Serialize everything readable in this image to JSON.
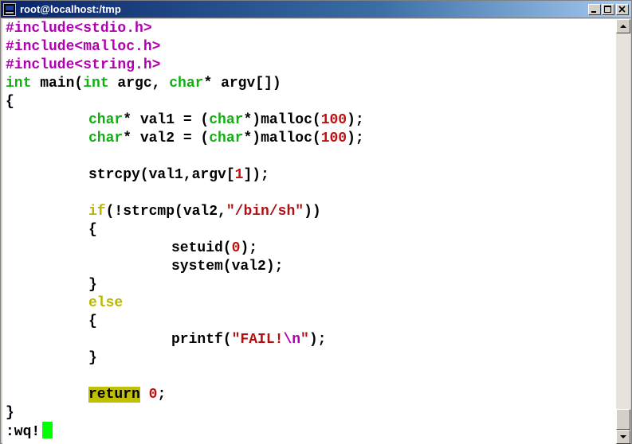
{
  "window": {
    "title": "root@localhost:/tmp"
  },
  "editor": {
    "lines": [
      {
        "segments": [
          {
            "t": "#include<stdio.h>",
            "c": "pre"
          }
        ]
      },
      {
        "segments": [
          {
            "t": "#include<malloc.h>",
            "c": "pre"
          }
        ]
      },
      {
        "segments": [
          {
            "t": "#include<string.h>",
            "c": "pre"
          }
        ]
      },
      {
        "segments": [
          {
            "t": "int",
            "c": "typ"
          },
          {
            "t": " main("
          },
          {
            "t": "int",
            "c": "typ"
          },
          {
            "t": " argc, "
          },
          {
            "t": "char",
            "c": "typ"
          },
          {
            "t": "* argv[])"
          }
        ]
      },
      {
        "segments": [
          {
            "t": "{"
          }
        ]
      },
      {
        "indent": 1,
        "segments": [
          {
            "t": "char",
            "c": "typ"
          },
          {
            "t": "* val1 = ("
          },
          {
            "t": "char",
            "c": "typ"
          },
          {
            "t": "*)malloc("
          },
          {
            "t": "100",
            "c": "num"
          },
          {
            "t": ");"
          }
        ]
      },
      {
        "indent": 1,
        "segments": [
          {
            "t": "char",
            "c": "typ"
          },
          {
            "t": "* val2 = ("
          },
          {
            "t": "char",
            "c": "typ"
          },
          {
            "t": "*)malloc("
          },
          {
            "t": "100",
            "c": "num"
          },
          {
            "t": ");"
          }
        ]
      },
      {
        "segments": []
      },
      {
        "indent": 1,
        "segments": [
          {
            "t": "strcpy(val1,argv["
          },
          {
            "t": "1",
            "c": "num"
          },
          {
            "t": "]);"
          }
        ]
      },
      {
        "segments": []
      },
      {
        "indent": 1,
        "segments": [
          {
            "t": "if",
            "c": "kw"
          },
          {
            "t": "(!strcmp(val2,"
          },
          {
            "t": "\"/bin/sh\"",
            "c": "str"
          },
          {
            "t": "))"
          }
        ]
      },
      {
        "indent": 1,
        "segments": [
          {
            "t": "{"
          }
        ]
      },
      {
        "indent": 2,
        "segments": [
          {
            "t": "setuid("
          },
          {
            "t": "0",
            "c": "num"
          },
          {
            "t": ");"
          }
        ]
      },
      {
        "indent": 2,
        "segments": [
          {
            "t": "system(val2);"
          }
        ]
      },
      {
        "indent": 1,
        "segments": [
          {
            "t": "}"
          }
        ]
      },
      {
        "indent": 1,
        "segments": [
          {
            "t": "else",
            "c": "kw"
          }
        ]
      },
      {
        "indent": 1,
        "segments": [
          {
            "t": "{"
          }
        ]
      },
      {
        "indent": 2,
        "segments": [
          {
            "t": "printf("
          },
          {
            "t": "\"FAIL!",
            "c": "str"
          },
          {
            "t": "\\n",
            "c": "spc"
          },
          {
            "t": "\"",
            "c": "str"
          },
          {
            "t": ");"
          }
        ]
      },
      {
        "indent": 1,
        "segments": [
          {
            "t": "}"
          }
        ]
      },
      {
        "segments": []
      },
      {
        "indent": 1,
        "segments": [
          {
            "t": "return",
            "c": "hl"
          },
          {
            "t": " "
          },
          {
            "t": "0",
            "c": "num"
          },
          {
            "t": ";"
          }
        ]
      },
      {
        "segments": [
          {
            "t": "}"
          }
        ]
      }
    ]
  },
  "command_line": {
    "text": ":wq!"
  },
  "colors": {
    "preprocessor": "#b000b0",
    "type": "#10b010",
    "number": "#c01010",
    "string": "#b01010",
    "keyword": "#b8b800",
    "search_highlight": "#c0c000",
    "cursor": "#00ff00"
  },
  "icons": {
    "app": "terminal-icon",
    "minimize": "minimize-icon",
    "maximize": "maximize-icon",
    "close": "close-icon",
    "scroll_up": "arrow-up-icon",
    "scroll_down": "arrow-down-icon"
  }
}
